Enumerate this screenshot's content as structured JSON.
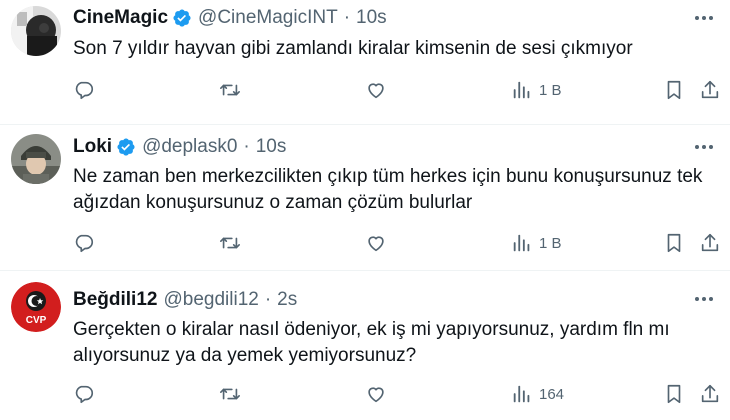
{
  "tweets": [
    {
      "name": "CineMagic",
      "handle": "@CineMagicINT",
      "separator": "·",
      "time": "10s",
      "verified": true,
      "text": "Son 7 yıldır hayvan gibi zamlandı kiralar kimsenin de sesi çıkmıyor",
      "views": "1 B"
    },
    {
      "name": "Loki",
      "handle": "@deplask0",
      "separator": "·",
      "time": "10s",
      "verified": true,
      "text": "Ne zaman ben merkezcilikten çıkıp tüm herkes için bunu konuşursunuz tek ağızdan konuşursunuz o zaman çözüm bulurlar",
      "views": "1 B"
    },
    {
      "name": "Beğdili12",
      "handle": "@begdili12",
      "separator": "·",
      "time": "2s",
      "verified": false,
      "text": "Gerçekten o kiralar nasıl ödeniyor, ek iş mi yapıyorsunuz, yardım fln mı alıyorsunuz ya da yemek yemiyorsunuz?",
      "views": "164",
      "avatar_label": "CVP"
    }
  ],
  "icons": {
    "reply": "reply-icon",
    "retweet": "retweet-icon",
    "like": "heart-icon",
    "views": "views-bar-chart-icon",
    "bookmark": "bookmark-icon",
    "share": "share-icon",
    "more": "more-dots-icon",
    "verified": "verified-badge-icon"
  },
  "colors": {
    "verified": "#1d9bf0",
    "secondary_text": "#536471",
    "primary_text": "#0f1419",
    "cvp_red": "#d21e1e"
  }
}
